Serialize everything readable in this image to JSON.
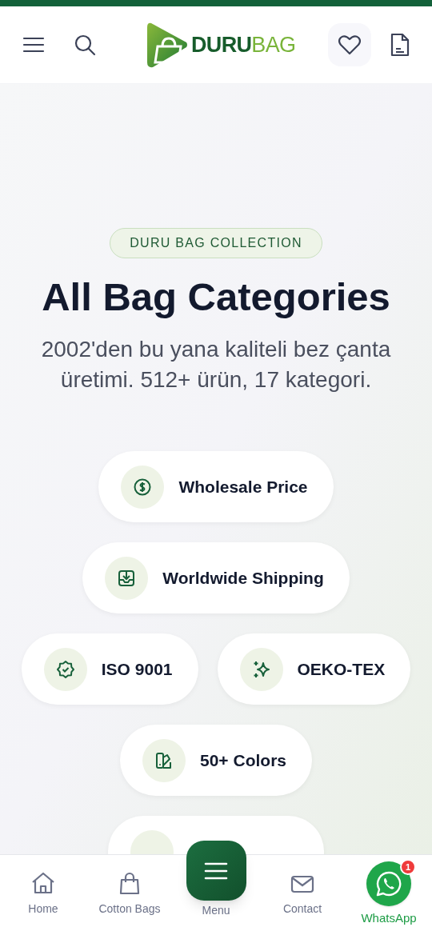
{
  "header": {
    "logo": {
      "primary": "DURU",
      "secondary": "BAG"
    }
  },
  "hero": {
    "badge": "DURU BAG COLLECTION",
    "title": "All Bag Categories",
    "subtitle": "2002'den bu yana kaliteli bez çanta üretimi. 512+ ürün, 17 kategori."
  },
  "features": [
    {
      "label": "Wholesale Price"
    },
    {
      "label": "Worldwide Shipping"
    },
    {
      "label": "ISO 9001"
    },
    {
      "label": "OEKO-TEX"
    },
    {
      "label": "50+ Colors"
    }
  ],
  "bottom_nav": [
    {
      "kind": "link",
      "label": "Home"
    },
    {
      "kind": "link",
      "label": "Cotton Bags"
    },
    {
      "kind": "fab",
      "label": "Menu"
    },
    {
      "kind": "link",
      "label": "Contact"
    },
    {
      "kind": "whatsapp",
      "label": "WhatsApp",
      "badge": "1"
    }
  ]
}
